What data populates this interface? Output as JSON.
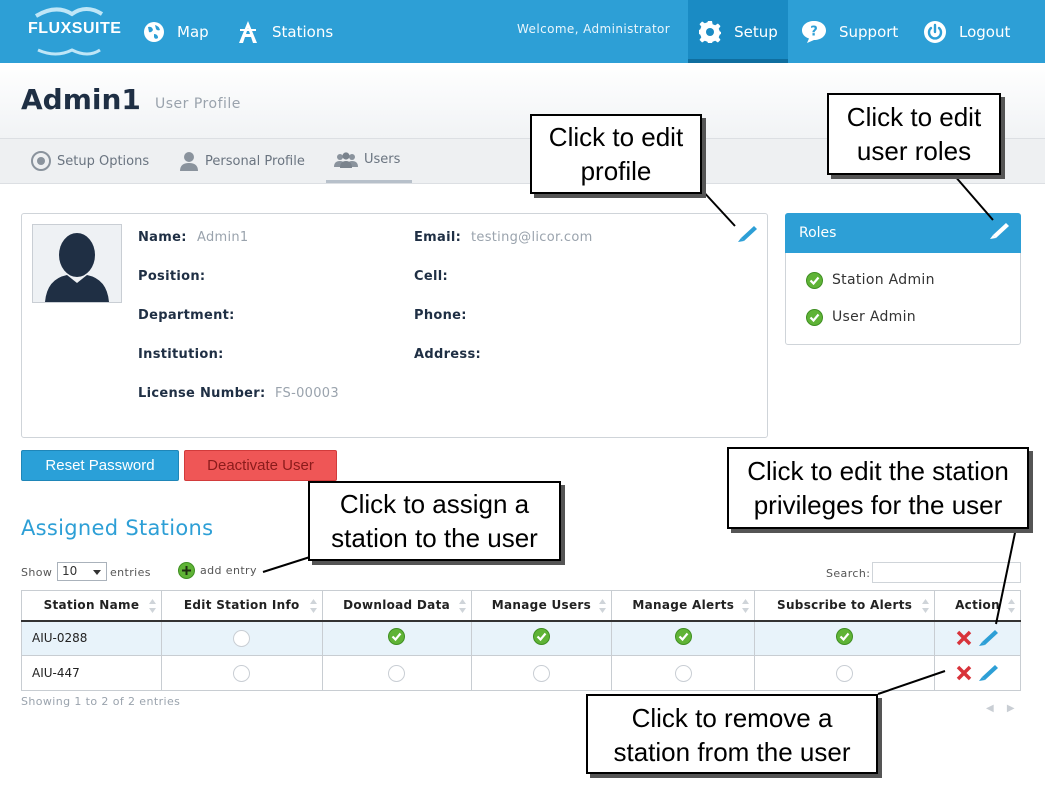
{
  "nav": {
    "logo": "FLUXSUITE",
    "map": "Map",
    "stations": "Stations",
    "welcome": "Welcome, Administrator",
    "setup": "Setup",
    "support": "Support",
    "logout": "Logout"
  },
  "header": {
    "title": "Admin1",
    "subtitle": "User Profile"
  },
  "tabs": {
    "setup_options": "Setup Options",
    "personal_profile": "Personal Profile",
    "users": "Users"
  },
  "profile": {
    "name_label": "Name:",
    "name_value": "Admin1",
    "email_label": "Email:",
    "email_value": "testing@licor.com",
    "position_label": "Position:",
    "cell_label": "Cell:",
    "department_label": "Department:",
    "phone_label": "Phone:",
    "institution_label": "Institution:",
    "address_label": "Address:",
    "license_label": "License Number:",
    "license_value": "FS-00003"
  },
  "roles": {
    "title": "Roles",
    "items": [
      "Station Admin",
      "User Admin"
    ]
  },
  "buttons": {
    "reset_password": "Reset Password",
    "deactivate_user": "Deactivate User"
  },
  "stations": {
    "title": "Assigned Stations",
    "show_label": "Show",
    "entries_value": "10",
    "entries_label": "entries",
    "add_entry": "add entry",
    "search_label": "Search:",
    "columns": [
      "Station Name",
      "Edit Station Info",
      "Download Data",
      "Manage Users",
      "Manage Alerts",
      "Subscribe to Alerts",
      "Action"
    ],
    "rows": [
      {
        "name": "AIU-0288",
        "edit_info": false,
        "download": true,
        "manage_users": true,
        "manage_alerts": true,
        "subscribe": true
      },
      {
        "name": "AIU-447",
        "edit_info": false,
        "download": false,
        "manage_users": false,
        "manage_alerts": false,
        "subscribe": false
      }
    ],
    "footer": "Showing 1 to 2 of 2 entries"
  },
  "callouts": {
    "edit_profile": [
      "Click to edit",
      "profile"
    ],
    "edit_roles": [
      "Click to edit",
      "user roles"
    ],
    "assign_station": [
      "Click to assign a",
      "station to the user"
    ],
    "edit_privileges": [
      "Click to edit the station",
      "privileges for the user"
    ],
    "remove_station": [
      "Click to remove a",
      "station from the user"
    ]
  },
  "colors": {
    "brand": "#2d9fd6",
    "danger": "#ef5656",
    "check": "#5fb336"
  }
}
